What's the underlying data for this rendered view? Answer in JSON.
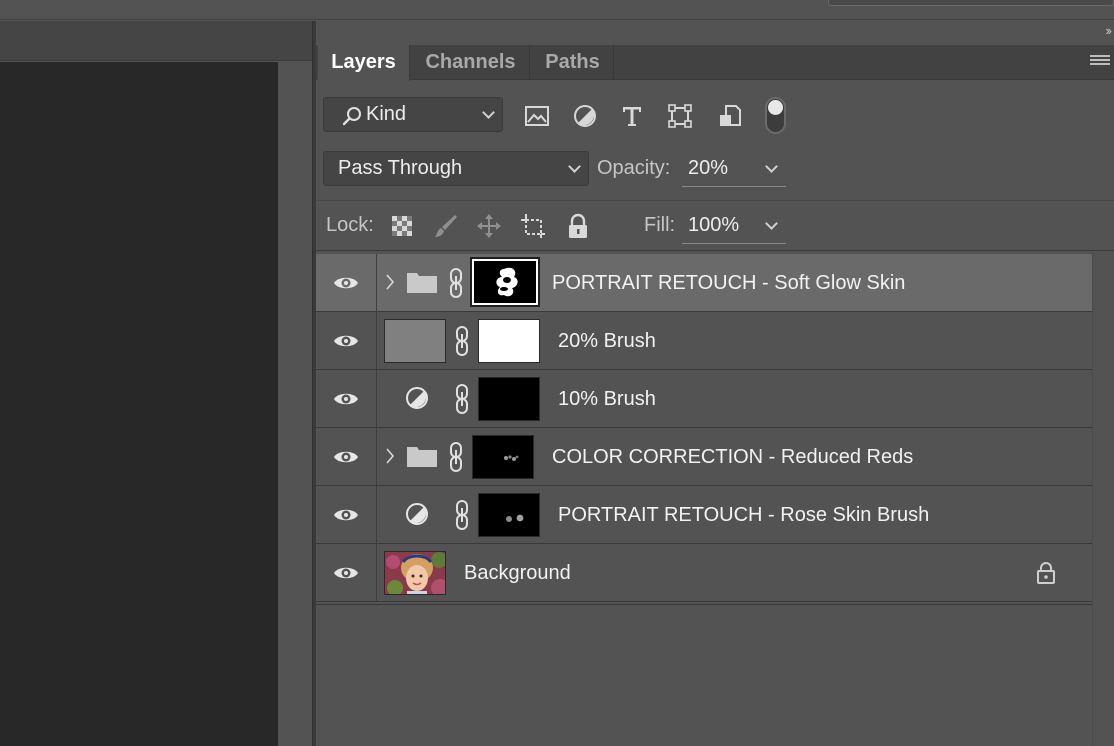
{
  "panel": {
    "collapse_icon": "double-chevron-right-icon",
    "menu_icon": "panel-menu-icon",
    "tabs": [
      {
        "label": "Layers",
        "active": true
      },
      {
        "label": "Channels",
        "active": false
      },
      {
        "label": "Paths",
        "active": false
      }
    ]
  },
  "filter": {
    "kind_label": "Kind",
    "icons": [
      "image-filter-icon",
      "adjustment-filter-icon",
      "type-filter-icon",
      "shape-filter-icon",
      "smart-object-filter-icon"
    ],
    "toggle_on": true
  },
  "blend": {
    "mode": "Pass Through",
    "opacity_label": "Opacity:",
    "opacity_value": "20%"
  },
  "lock": {
    "label": "Lock:",
    "icons": [
      "lock-transparent-pixels-icon",
      "lock-image-pixels-icon",
      "lock-position-icon",
      "lock-artboard-icon",
      "lock-all-icon"
    ],
    "fill_label": "Fill:",
    "fill_value": "100%"
  },
  "layers": [
    {
      "name": "PORTRAIT RETOUCH - Soft Glow Skin",
      "type": "group",
      "selected": true,
      "visible": true
    },
    {
      "name": "20% Brush",
      "type": "pixel",
      "selected": false,
      "visible": true
    },
    {
      "name": "10% Brush",
      "type": "adjustment",
      "selected": false,
      "visible": true
    },
    {
      "name": "COLOR CORRECTION - Reduced Reds",
      "type": "group",
      "selected": false,
      "visible": true
    },
    {
      "name": "PORTRAIT RETOUCH - Rose Skin Brush",
      "type": "adjustment",
      "selected": false,
      "visible": true
    },
    {
      "name": "Background",
      "type": "background",
      "selected": false,
      "visible": true,
      "locked": true
    }
  ],
  "colors": {
    "panel_bg": "#535353",
    "selected_row": "#6a6a6a",
    "tab_bar": "#424242",
    "canvas": "#282828"
  }
}
